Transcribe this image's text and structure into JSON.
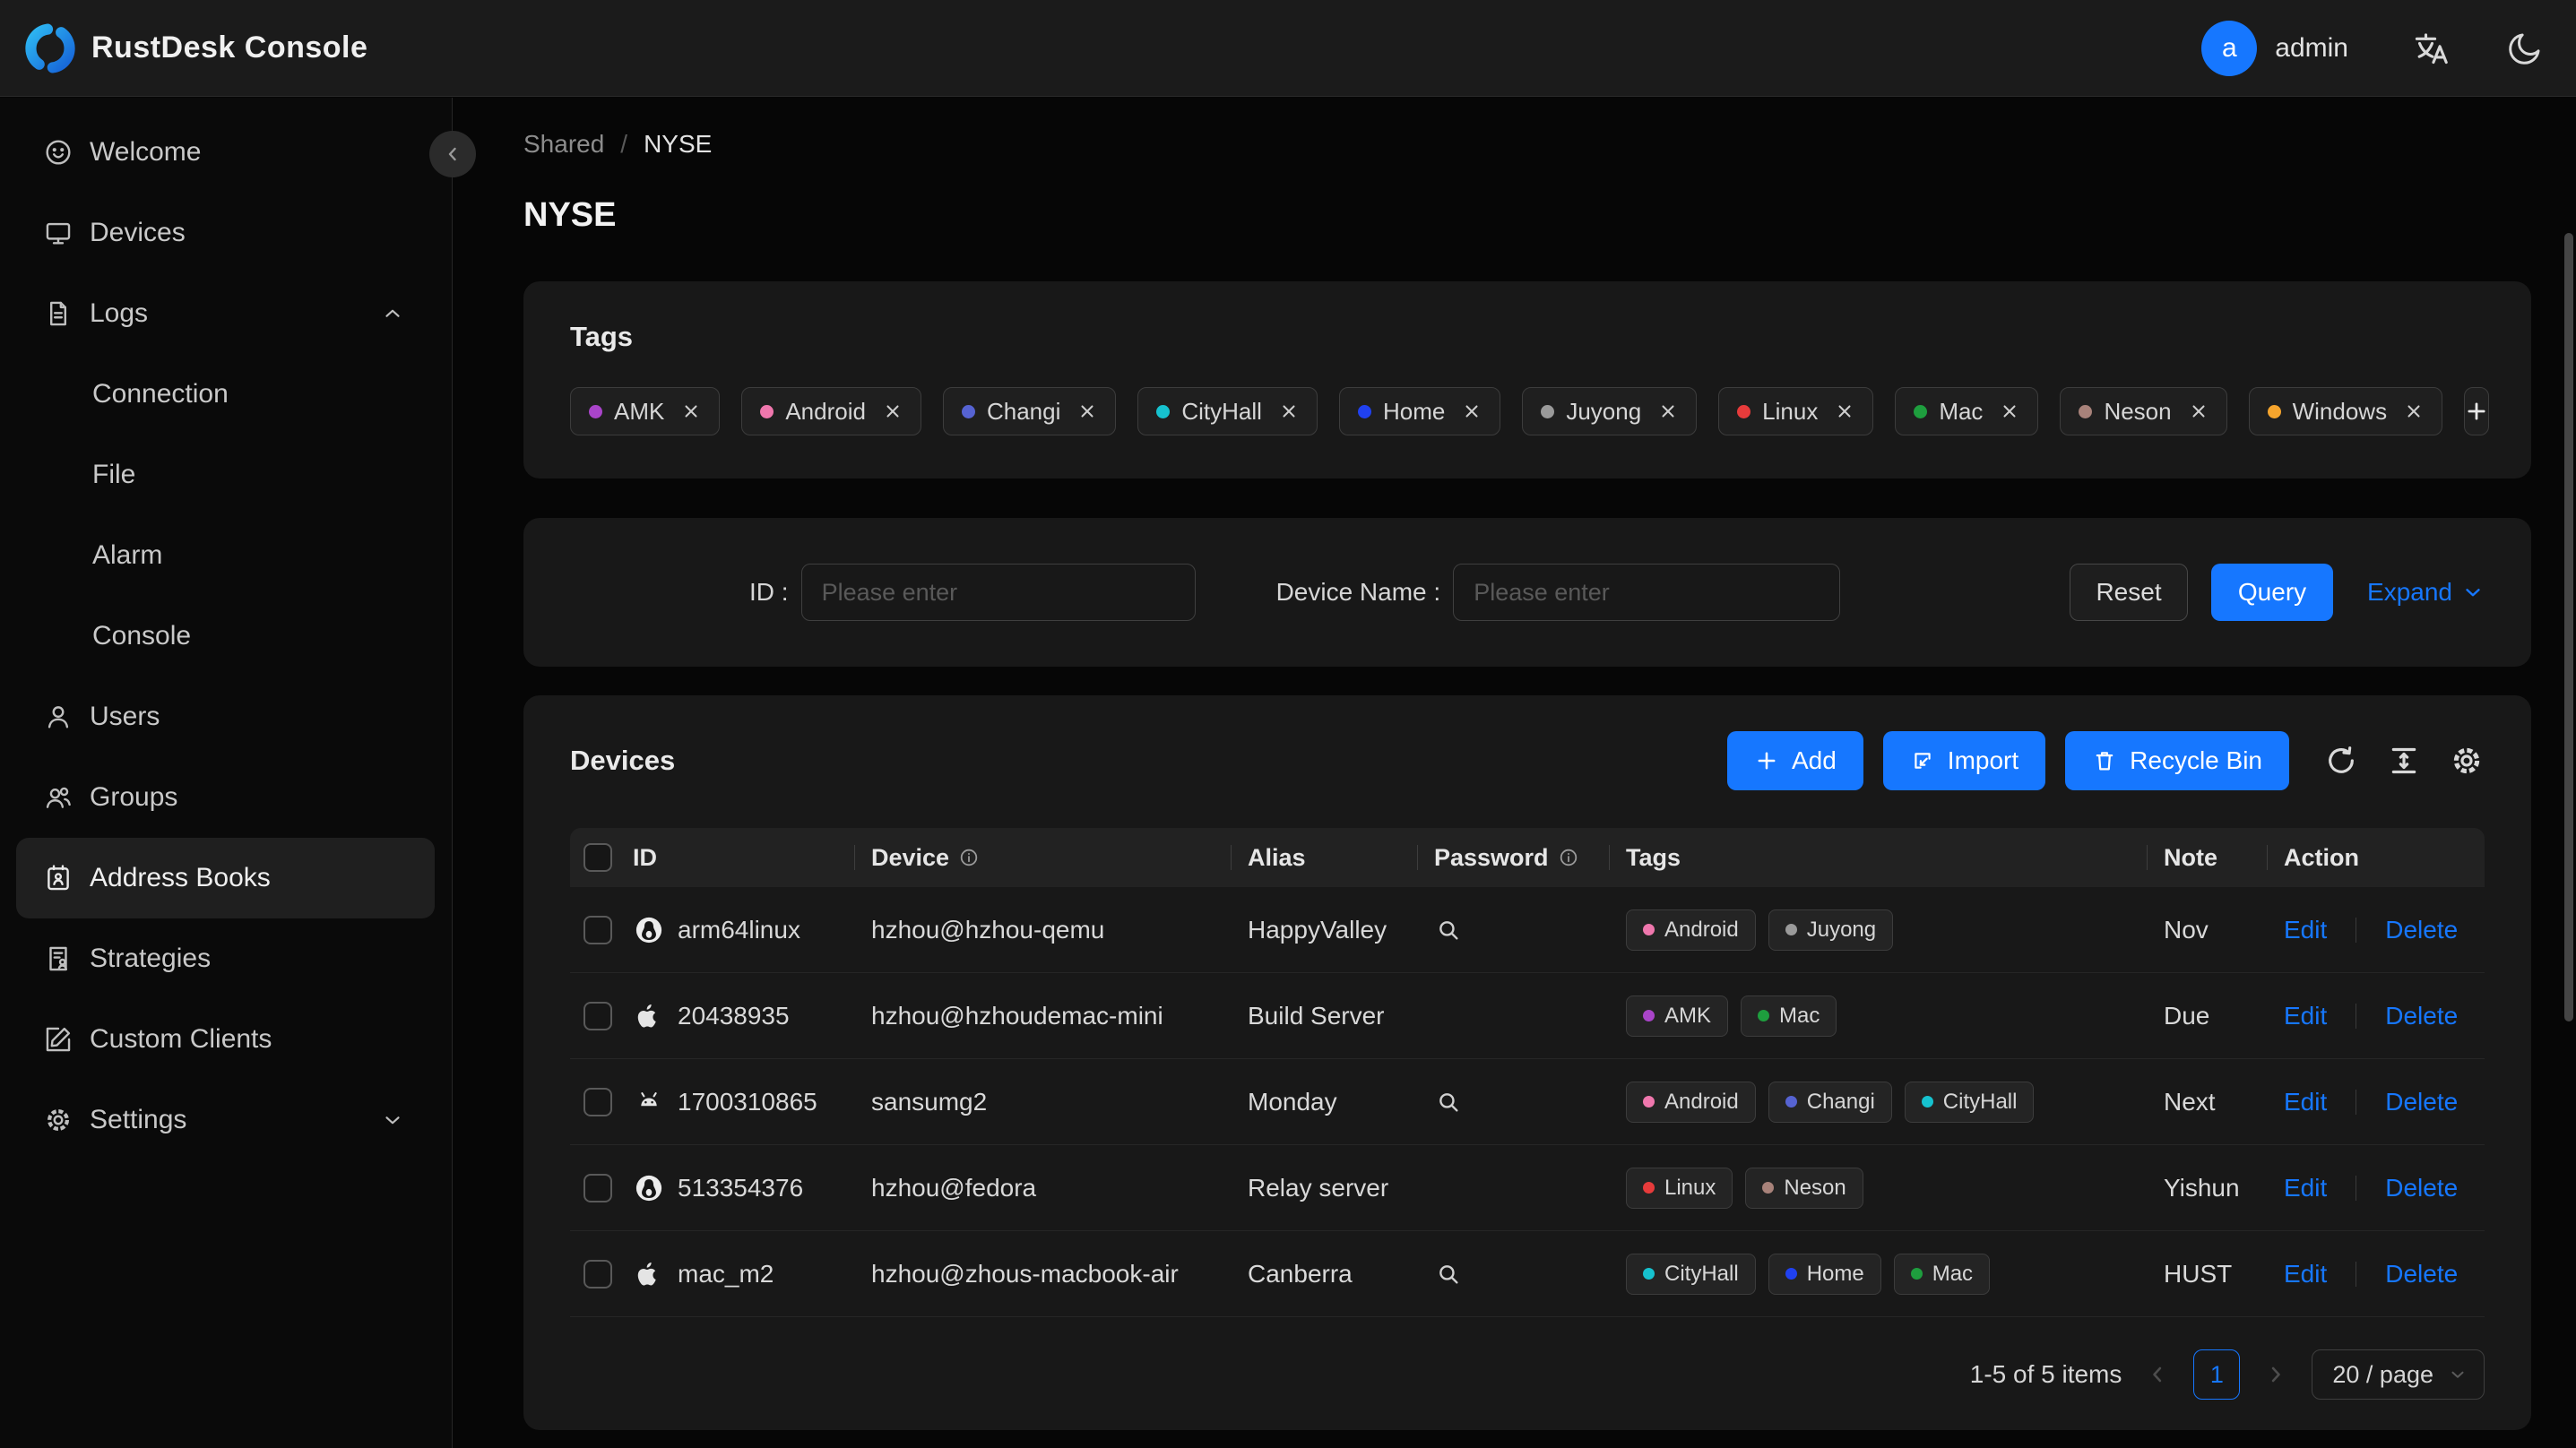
{
  "header": {
    "title": "RustDesk Console",
    "user_initial": "a",
    "username": "admin"
  },
  "breadcrumb": {
    "parent": "Shared",
    "separator": "/",
    "current": "NYSE"
  },
  "page": {
    "title": "NYSE"
  },
  "sidebar": {
    "items": [
      {
        "label": "Welcome"
      },
      {
        "label": "Devices"
      },
      {
        "label": "Logs"
      },
      {
        "label": "Connection"
      },
      {
        "label": "File"
      },
      {
        "label": "Alarm"
      },
      {
        "label": "Console"
      },
      {
        "label": "Users"
      },
      {
        "label": "Groups"
      },
      {
        "label": "Address Books"
      },
      {
        "label": "Strategies"
      },
      {
        "label": "Custom Clients"
      },
      {
        "label": "Settings"
      }
    ]
  },
  "tags_card": {
    "title": "Tags",
    "tags": [
      {
        "label": "AMK",
        "color": "#a944c9"
      },
      {
        "label": "Android",
        "color": "#ef77ad"
      },
      {
        "label": "Changi",
        "color": "#5663d2"
      },
      {
        "label": "CityHall",
        "color": "#16c2cf"
      },
      {
        "label": "Home",
        "color": "#2041f0"
      },
      {
        "label": "Juyong",
        "color": "#9a9a9a"
      },
      {
        "label": "Linux",
        "color": "#e73b3b"
      },
      {
        "label": "Mac",
        "color": "#1e9e3e"
      },
      {
        "label": "Neson",
        "color": "#a8827a"
      },
      {
        "label": "Windows",
        "color": "#f6a52d"
      }
    ]
  },
  "filter": {
    "id_label": "ID :",
    "device_label": "Device Name :",
    "placeholder": "Please enter",
    "reset": "Reset",
    "query": "Query",
    "expand": "Expand"
  },
  "devices_panel": {
    "title": "Devices",
    "add": "Add",
    "import": "Import",
    "recycle_bin": "Recycle Bin"
  },
  "table": {
    "columns": {
      "id": "ID",
      "device": "Device",
      "alias": "Alias",
      "password": "Password",
      "tags": "Tags",
      "note": "Note",
      "action": "Action"
    },
    "actions": {
      "edit": "Edit",
      "delete": "Delete"
    },
    "rows": [
      {
        "id": "arm64linux",
        "device": "hzhou@hzhou-qemu",
        "alias": "HappyValley",
        "note": "Nov",
        "tags": [
          {
            "label": "Android",
            "color": "#ef77ad"
          },
          {
            "label": "Juyong",
            "color": "#9a9a9a"
          }
        ]
      },
      {
        "id": "20438935",
        "device": "hzhou@hzhoudemac-mini",
        "alias": "Build Server",
        "note": "Due",
        "tags": [
          {
            "label": "AMK",
            "color": "#a944c9"
          },
          {
            "label": "Mac",
            "color": "#1e9e3e"
          }
        ]
      },
      {
        "id": "1700310865",
        "device": "sansumg2",
        "alias": "Monday",
        "note": "Next",
        "tags": [
          {
            "label": "Android",
            "color": "#ef77ad"
          },
          {
            "label": "Changi",
            "color": "#5663d2"
          },
          {
            "label": "CityHall",
            "color": "#16c2cf"
          }
        ]
      },
      {
        "id": "513354376",
        "device": "hzhou@fedora",
        "alias": "Relay server",
        "note": "Yishun",
        "tags": [
          {
            "label": "Linux",
            "color": "#e73b3b"
          },
          {
            "label": "Neson",
            "color": "#a8827a"
          }
        ]
      },
      {
        "id": "mac_m2",
        "device": "hzhou@zhous-macbook-air",
        "alias": "Canberra",
        "note": "HUST",
        "tags": [
          {
            "label": "CityHall",
            "color": "#16c2cf"
          },
          {
            "label": "Home",
            "color": "#2041f0"
          },
          {
            "label": "Mac",
            "color": "#1e9e3e"
          }
        ]
      }
    ]
  },
  "pagination": {
    "total": "1-5 of 5 items",
    "page": "1",
    "page_size": "20 / page"
  },
  "colors": {
    "accent": "#1677ff"
  }
}
